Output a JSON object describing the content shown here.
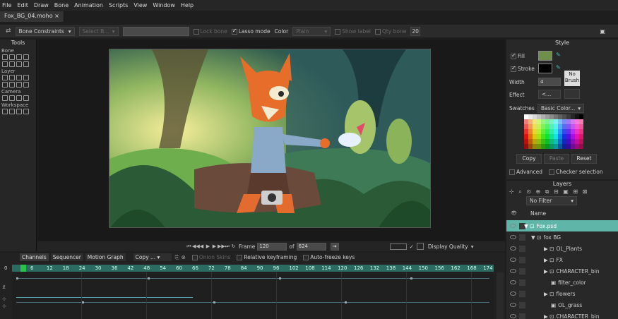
{
  "menu": [
    "File",
    "Edit",
    "Draw",
    "Bone",
    "Animation",
    "Scripts",
    "View",
    "Window",
    "Help"
  ],
  "document_tab": "Fox_BG_04.moho ×",
  "toolbar": {
    "bone_constraints": "Bone Constraints",
    "select_b": "Select B...",
    "lock_bone": "Lock bone",
    "lasso_mode": "Lasso mode",
    "color_label": "Color",
    "color_value": "Plain",
    "show_label": "Show label",
    "qty_bone": "Qty bone",
    "number": "20"
  },
  "tools": {
    "title": "Tools",
    "sections": [
      "Bone",
      "Layer",
      "Camera",
      "Workspace"
    ]
  },
  "canvas_controls": {
    "frame_label": "Frame",
    "frame_value": "120",
    "of_label": "of",
    "total_frames": "624",
    "display_quality": "Display Quality"
  },
  "timeline": {
    "tabs": [
      "Channels",
      "Sequencer",
      "Motion Graph"
    ],
    "copy": "Copy ...",
    "onion_skins": "Onion Skins",
    "relative_keyframing": "Relative keyframing",
    "auto_freeze_keys": "Auto-freeze keys",
    "ruler_start": "0",
    "ticks": [
      "6",
      "12",
      "18",
      "24",
      "30",
      "36",
      "42",
      "48",
      "54",
      "60",
      "66",
      "72",
      "78",
      "84",
      "90",
      "96",
      "102",
      "108",
      "114",
      "120",
      "126",
      "132",
      "138",
      "144",
      "150",
      "156",
      "162",
      "168",
      "174"
    ]
  },
  "style": {
    "title": "Style",
    "fill_label": "Fill",
    "stroke_label": "Stroke",
    "width_label": "Width",
    "width_value": "4",
    "no_brush": "No Brush",
    "effect_label": "Effect",
    "effect_value": "<...",
    "swatches_label": "Swatches",
    "swatches_value": "Basic Color...",
    "copy": "Copy",
    "paste": "Paste",
    "reset": "Reset",
    "advanced": "Advanced",
    "checker_selection": "Checker selection",
    "fill_color": "#6f8f4a",
    "stroke_color": "#000000"
  },
  "layers": {
    "title": "Layers",
    "filter": "No Filter",
    "name_header": "Name",
    "items": [
      {
        "name": "Fox.psd",
        "selected": true
      },
      {
        "name": "fox BG",
        "selected": false
      },
      {
        "name": "OL_Plants",
        "selected": false
      },
      {
        "name": "FX",
        "selected": false
      },
      {
        "name": "CHARACTER_bin",
        "selected": false
      },
      {
        "name": "filter_color",
        "selected": false
      },
      {
        "name": "flowers",
        "selected": false
      },
      {
        "name": "OL_grass",
        "selected": false
      },
      {
        "name": "CHARACTER_bin",
        "selected": false
      }
    ]
  }
}
